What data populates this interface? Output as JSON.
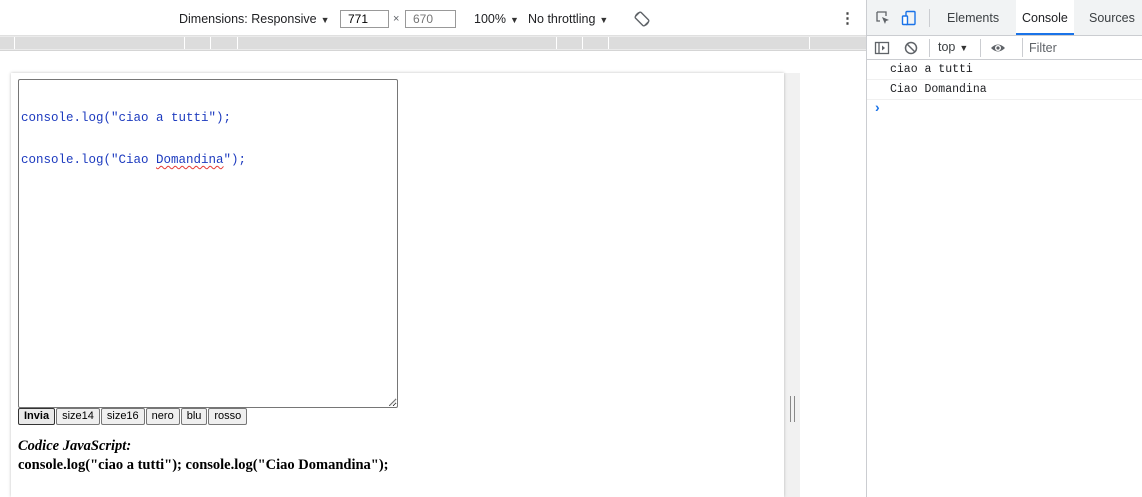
{
  "device_toolbar": {
    "dimensions_label": "Dimensions: Responsive",
    "width_value": "771",
    "height_placeholder": "670",
    "times_symbol": "×",
    "zoom": "100%",
    "throttling": "No throttling",
    "caret": "▼",
    "more_options": "⋮"
  },
  "page": {
    "editor_lines": [
      "console.log(\"ciao a tutti\");",
      "console.log(\"Ciao ",
      "Domandina",
      "\");"
    ],
    "buttons": [
      "Invia",
      "size14",
      "size16",
      "nero",
      "blu",
      "rosso"
    ],
    "code_label": "Codice JavaScript:",
    "code_output": "console.log(\"ciao a tutti\"); console.log(\"Ciao Domandina\");"
  },
  "devtools": {
    "tabs": [
      "Elements",
      "Console",
      "Sources"
    ],
    "active_tab": "Console",
    "context": "top",
    "filter_placeholder": "Filter",
    "messages": [
      "ciao a tutti",
      "Ciao Domandina"
    ],
    "prompt_symbol": "›",
    "accent_color": "#1a73e8"
  }
}
